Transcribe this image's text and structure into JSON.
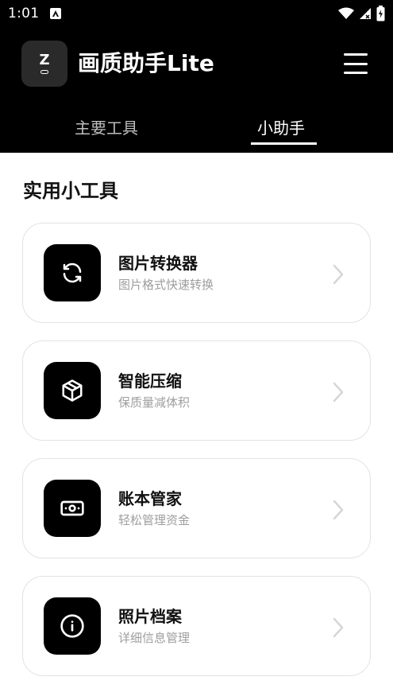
{
  "status_bar": {
    "time": "1:01",
    "notification_icon": "a-icon",
    "icons": [
      "wifi-icon",
      "signal-icon",
      "battery-charging-icon"
    ]
  },
  "header": {
    "app_title": "画质助手Lite",
    "logo_letter": "Z",
    "menu_icon": "hamburger-menu-icon"
  },
  "tabs": [
    {
      "label": "主要工具",
      "active": false
    },
    {
      "label": "小助手",
      "active": true
    }
  ],
  "section": {
    "title": "实用小工具"
  },
  "tools": [
    {
      "title": "图片转换器",
      "subtitle": "图片格式快速转换",
      "icon": "refresh-icon"
    },
    {
      "title": "智能压缩",
      "subtitle": "保质量减体积",
      "icon": "box-icon"
    },
    {
      "title": "账本管家",
      "subtitle": "轻松管理资金",
      "icon": "banknote-icon"
    },
    {
      "title": "照片档案",
      "subtitle": "详细信息管理",
      "icon": "info-icon"
    }
  ],
  "colors": {
    "header_bg": "#000000",
    "card_border": "#e3e3e3",
    "subtitle": "#9e9e9e",
    "inactive_tab": "#bdbdbd"
  }
}
